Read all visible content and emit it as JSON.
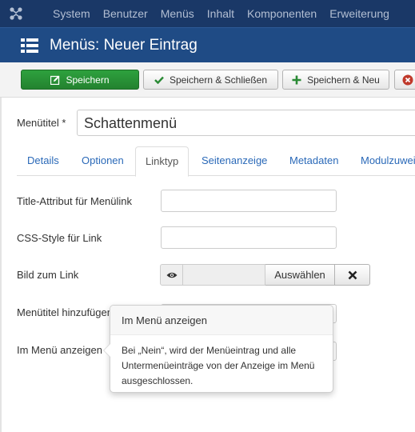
{
  "topnav": {
    "items": [
      "System",
      "Benutzer",
      "Menüs",
      "Inhalt",
      "Komponenten",
      "Erweiterung"
    ]
  },
  "header": {
    "title": "Menüs: Neuer Eintrag"
  },
  "toolbar": {
    "save_label": "Speichern",
    "save_close_label": "Speichern & Schließen",
    "save_new_label": "Speichern & Neu",
    "save_color": "#2ea13e"
  },
  "form": {
    "menu_title_label": "Menütitel *",
    "menu_title_value": "Schattenmenü",
    "tabs": [
      "Details",
      "Optionen",
      "Linktyp",
      "Seitenanzeige",
      "Metadaten",
      "Modulzuwei"
    ],
    "active_tab": "Linktyp",
    "title_attr_label": "Title-Attribut für Menülink",
    "title_attr_value": "",
    "css_style_label": "CSS-Style für Link",
    "css_style_value": "",
    "image_label": "Bild zum Link",
    "image_select_label": "Auswählen",
    "add_title_label": "Menütitel hinzufügen",
    "show_in_menu_label": "Im Menü anzeigen"
  },
  "popover": {
    "title": "Im Menü anzeigen",
    "body": "Bei „Nein“, wird der Menüeintrag und alle Untermenüeinträge von der Anzeige im Menü ausgeschlossen."
  }
}
